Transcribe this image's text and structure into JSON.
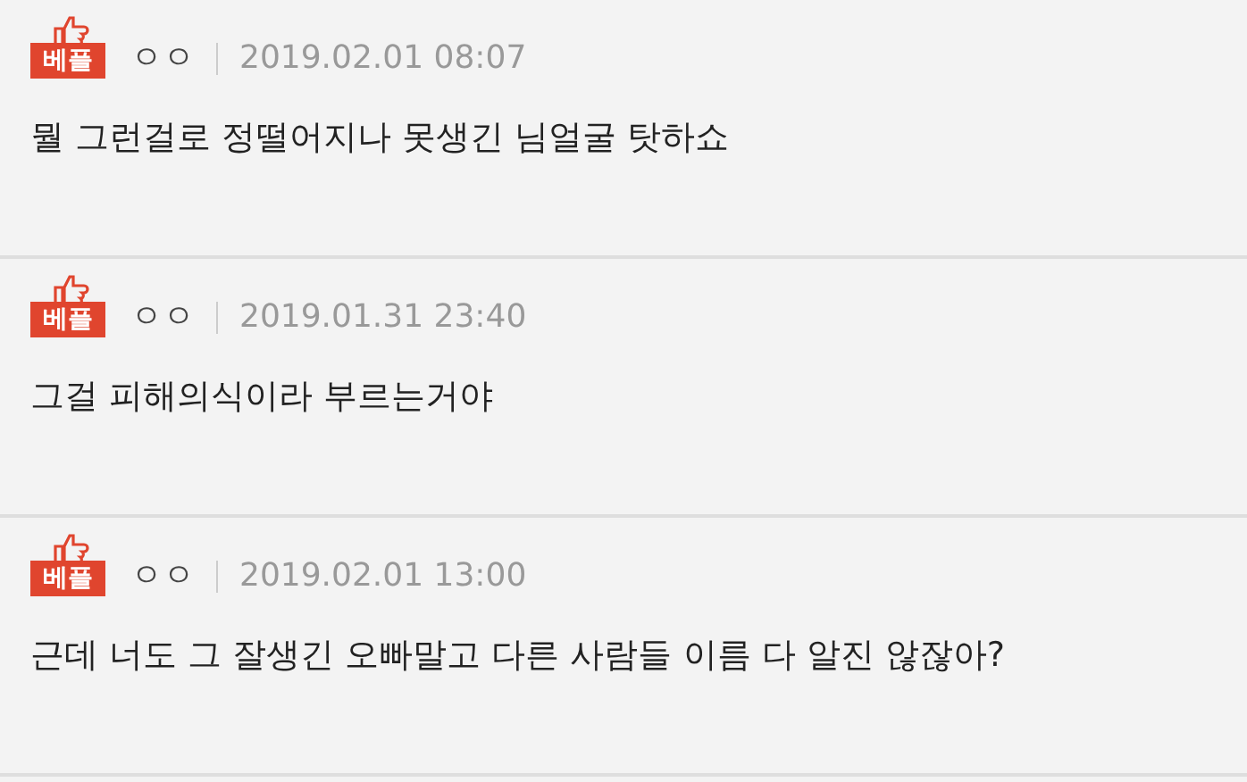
{
  "comments": [
    {
      "badge": "베플",
      "author": "ㅇㅇ",
      "date": "2019.02.01 08:07",
      "text": "뭘 그런걸로 정떨어지나 못생긴 님얼굴 탓하쇼"
    },
    {
      "badge": "베플",
      "author": "ㅇㅇ",
      "date": "2019.01.31 23:40",
      "text": "그걸 피해의식이라 부르는거야"
    },
    {
      "badge": "베플",
      "author": "ㅇㅇ",
      "date": "2019.02.01 13:00",
      "text": "근데 너도 그 잘생긴 오빠말고 다른 사람들 이름 다 알진 않잖아?"
    }
  ]
}
